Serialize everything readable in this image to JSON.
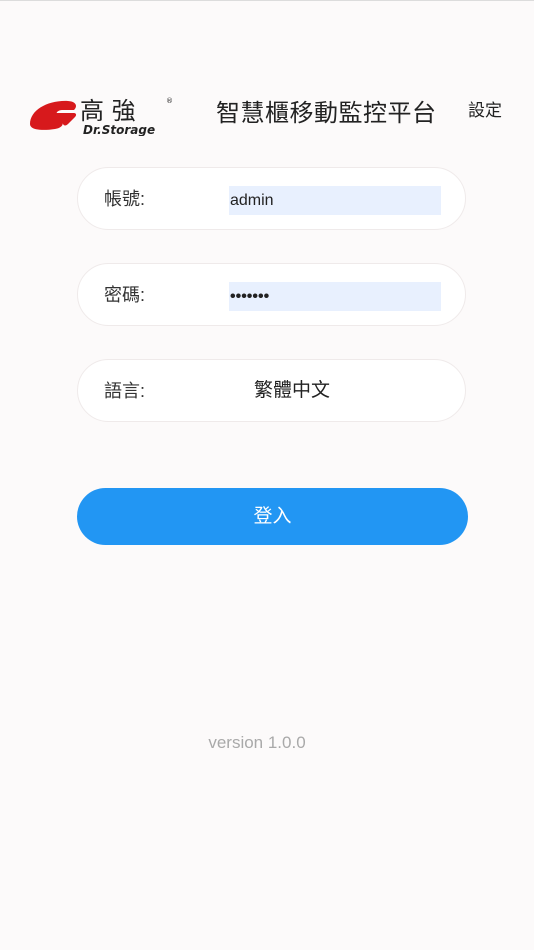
{
  "header": {
    "logo": {
      "brand_chinese": "高 強",
      "brand_english": "Dr.Storage",
      "registered_mark": "®",
      "brand_color": "#d7191c"
    },
    "app_title": "智慧櫃移動監控平台",
    "settings_label": "設定"
  },
  "form": {
    "account": {
      "label": "帳號:",
      "value": "admin"
    },
    "password": {
      "label": "密碼:",
      "value": "1234567"
    },
    "language": {
      "label": "語言:",
      "value": "繁體中文"
    },
    "login_label": "登入"
  },
  "footer": {
    "version": "version 1.0.0"
  },
  "colors": {
    "accent": "#2296f3",
    "autofill_bg": "#e8f0fe",
    "page_bg": "#fcfafa",
    "version_text": "#a9a9a9"
  }
}
